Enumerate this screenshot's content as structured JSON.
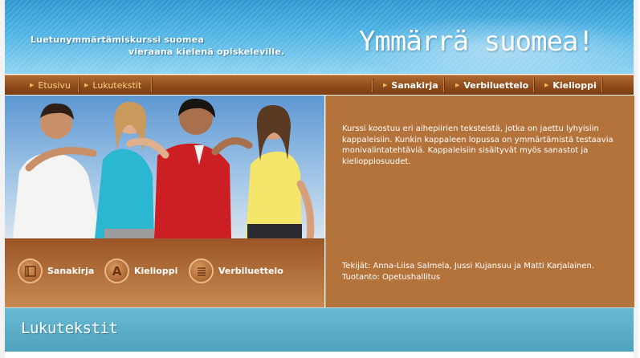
{
  "header": {
    "tagline_line1": "Luetunymmärtämiskurssi suomea",
    "tagline_line2": "vieraana kielenä opiskeleville.",
    "site_title": "Ymmärrä suomea!"
  },
  "nav": {
    "left": [
      {
        "label": "Etusivu"
      },
      {
        "label": "Lukutekstit"
      }
    ],
    "right": [
      {
        "label": "Sanakirja"
      },
      {
        "label": "Verbiluettelo"
      },
      {
        "label": "Kielioppi"
      }
    ]
  },
  "tools": [
    {
      "label": "Sanakirja",
      "icon": "book-icon"
    },
    {
      "label": "Kielioppi",
      "icon": "letter-a-icon"
    },
    {
      "label": "Verbiluettelo",
      "icon": "list-icon"
    }
  ],
  "info": {
    "description": "Kurssi koostuu eri aihepiirien teksteistä, jotka on jaettu lyhyisiin kappaleisiin. Kunkin kappaleen lopussa on ymmärtämistä testaavia monivalintatehtäviä. Kappaleisiin sisältyvät myös sanastot ja kielioppiosuudet.",
    "authors": "Tekijät: Anna-Liisa Salmela, Jussi Kujansuu ja Matti Karjalainen.",
    "producer": "Tuotanto: Opetushallitus"
  },
  "section": {
    "title": "Lukutekstit"
  },
  "colors": {
    "header_blue": "#4eb3e4",
    "nav_brown": "#8d4a1a",
    "info_brown": "#b5733c",
    "band_teal": "#5aaec8"
  }
}
